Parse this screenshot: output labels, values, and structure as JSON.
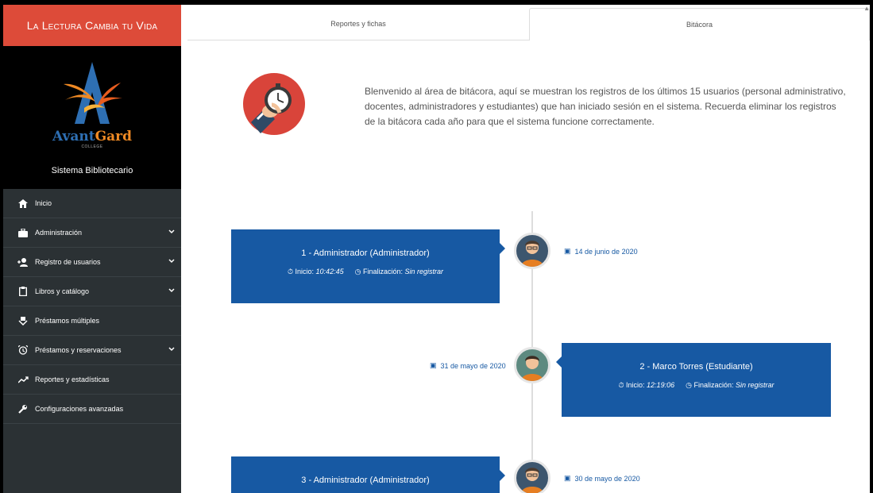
{
  "sidebar": {
    "brand": "La Lectura Cambia tu Vida",
    "logo": {
      "name_part1": "Avant",
      "name_part2": "Gard",
      "sub": "COLLEGE"
    },
    "system_name": "Sistema Bibliotecario",
    "items": [
      {
        "label": "Inicio",
        "icon": "home-icon",
        "has_submenu": false
      },
      {
        "label": "Administración",
        "icon": "briefcase-icon",
        "has_submenu": true
      },
      {
        "label": "Registro de usuarios",
        "icon": "user-add-icon",
        "has_submenu": true
      },
      {
        "label": "Libros y catálogo",
        "icon": "clipboard-icon",
        "has_submenu": true
      },
      {
        "label": "Préstamos múltiples",
        "icon": "dolly-icon",
        "has_submenu": false
      },
      {
        "label": "Préstamos y reservaciones",
        "icon": "alarm-clock-icon",
        "has_submenu": true
      },
      {
        "label": "Reportes y estadísticas",
        "icon": "trend-icon",
        "has_submenu": false
      },
      {
        "label": "Configuraciones avanzadas",
        "icon": "wrench-icon",
        "has_submenu": false
      }
    ]
  },
  "tabs": [
    {
      "label": "Reportes y fichas",
      "active": false
    },
    {
      "label": "Bitácora",
      "active": true
    }
  ],
  "intro": {
    "text": "Blenvenido al área de bitácora, aquí se muestran los registros de los últimos 15 usuarios (personal administrativo, docentes, administradores y estudiantes) que han iniciado sesión en el sistema. Recuerda eliminar los registros de la bitácora cada año para que el sistema funcione correctamente."
  },
  "timeline": {
    "start_label": "Inicio:",
    "end_label": "Finalización:",
    "entries": [
      {
        "title": "1 - Administrador (Administrador)",
        "start": "10:42:45",
        "end": "Sin registrar",
        "date": "14 de junio de 2020"
      },
      {
        "title": "2 - Marco Torres (Estudiante)",
        "start": "12:19:06",
        "end": "Sin registrar",
        "date": "31 de mayo de 2020"
      },
      {
        "title": "3 - Administrador (Administrador)",
        "start": "",
        "end": "",
        "date": "30 de mayo de 2020"
      }
    ]
  },
  "colors": {
    "brand_red": "#dd4b39",
    "sidebar": "#2b3134",
    "card_blue": "#1759a3"
  }
}
